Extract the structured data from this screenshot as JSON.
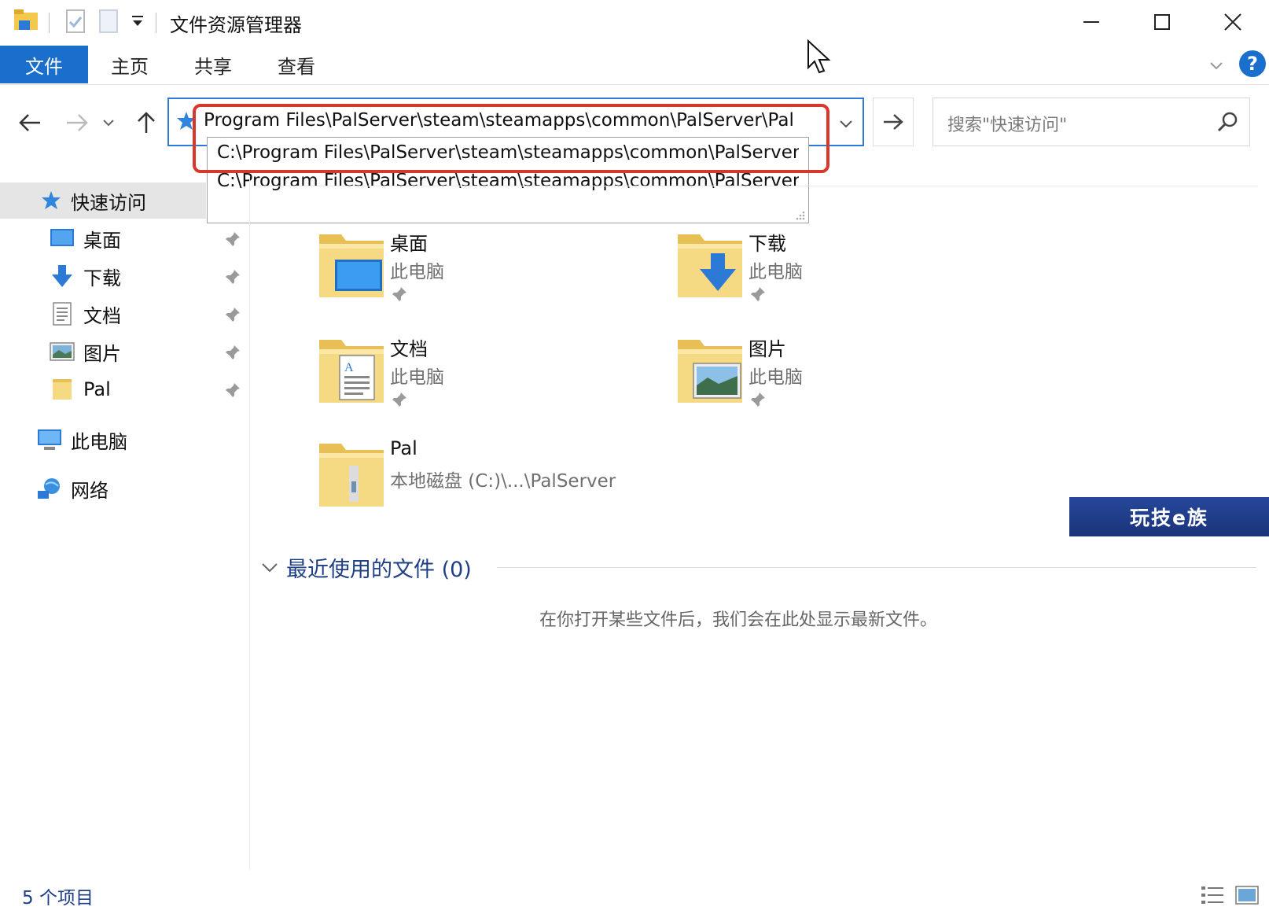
{
  "window": {
    "title": "文件资源管理器",
    "minimize_glyph": "—",
    "maximize_glyph": "☐",
    "close_glyph": "✕"
  },
  "ribbon": {
    "tabs": [
      "文件",
      "主页",
      "共享",
      "查看"
    ],
    "help_glyph": "?"
  },
  "address": {
    "text": "Program Files\\PalServer\\steam\\steamapps\\common\\PalServer\\Pal",
    "suggestions": [
      "C:\\Program Files\\PalServer\\steam\\steamapps\\common\\PalServer",
      "C:\\Program Files\\PalServer\\steam\\steamapps\\common\\PalServer"
    ]
  },
  "search": {
    "placeholder": "搜索\"快速访问\""
  },
  "sidebar": {
    "quick_access": "快速访问",
    "pinned": [
      {
        "label": "桌面",
        "icon": "desktop-icon"
      },
      {
        "label": "下载",
        "icon": "download-icon"
      },
      {
        "label": "文档",
        "icon": "document-icon"
      },
      {
        "label": "图片",
        "icon": "picture-icon"
      },
      {
        "label": "Pal",
        "icon": "folder-icon"
      }
    ],
    "this_pc": "此电脑",
    "network": "网络"
  },
  "folders": [
    {
      "name": "桌面",
      "location": "此电脑"
    },
    {
      "name": "下载",
      "location": "此电脑"
    },
    {
      "name": "文档",
      "location": "此电脑"
    },
    {
      "name": "图片",
      "location": "此电脑"
    },
    {
      "name": "Pal",
      "location": "本地磁盘 (C:)\\...\\PalServer"
    }
  ],
  "recent": {
    "title": "最近使用的文件 (0)",
    "empty_text": "在你打开某些文件后，我们会在此处显示最新文件。"
  },
  "watermark": "玩技e族",
  "status": {
    "items_count": "5 个项目"
  },
  "colors": {
    "accent": "#1a6fcc",
    "highlight_box": "#d6382b",
    "folder": "#f3d27a"
  }
}
